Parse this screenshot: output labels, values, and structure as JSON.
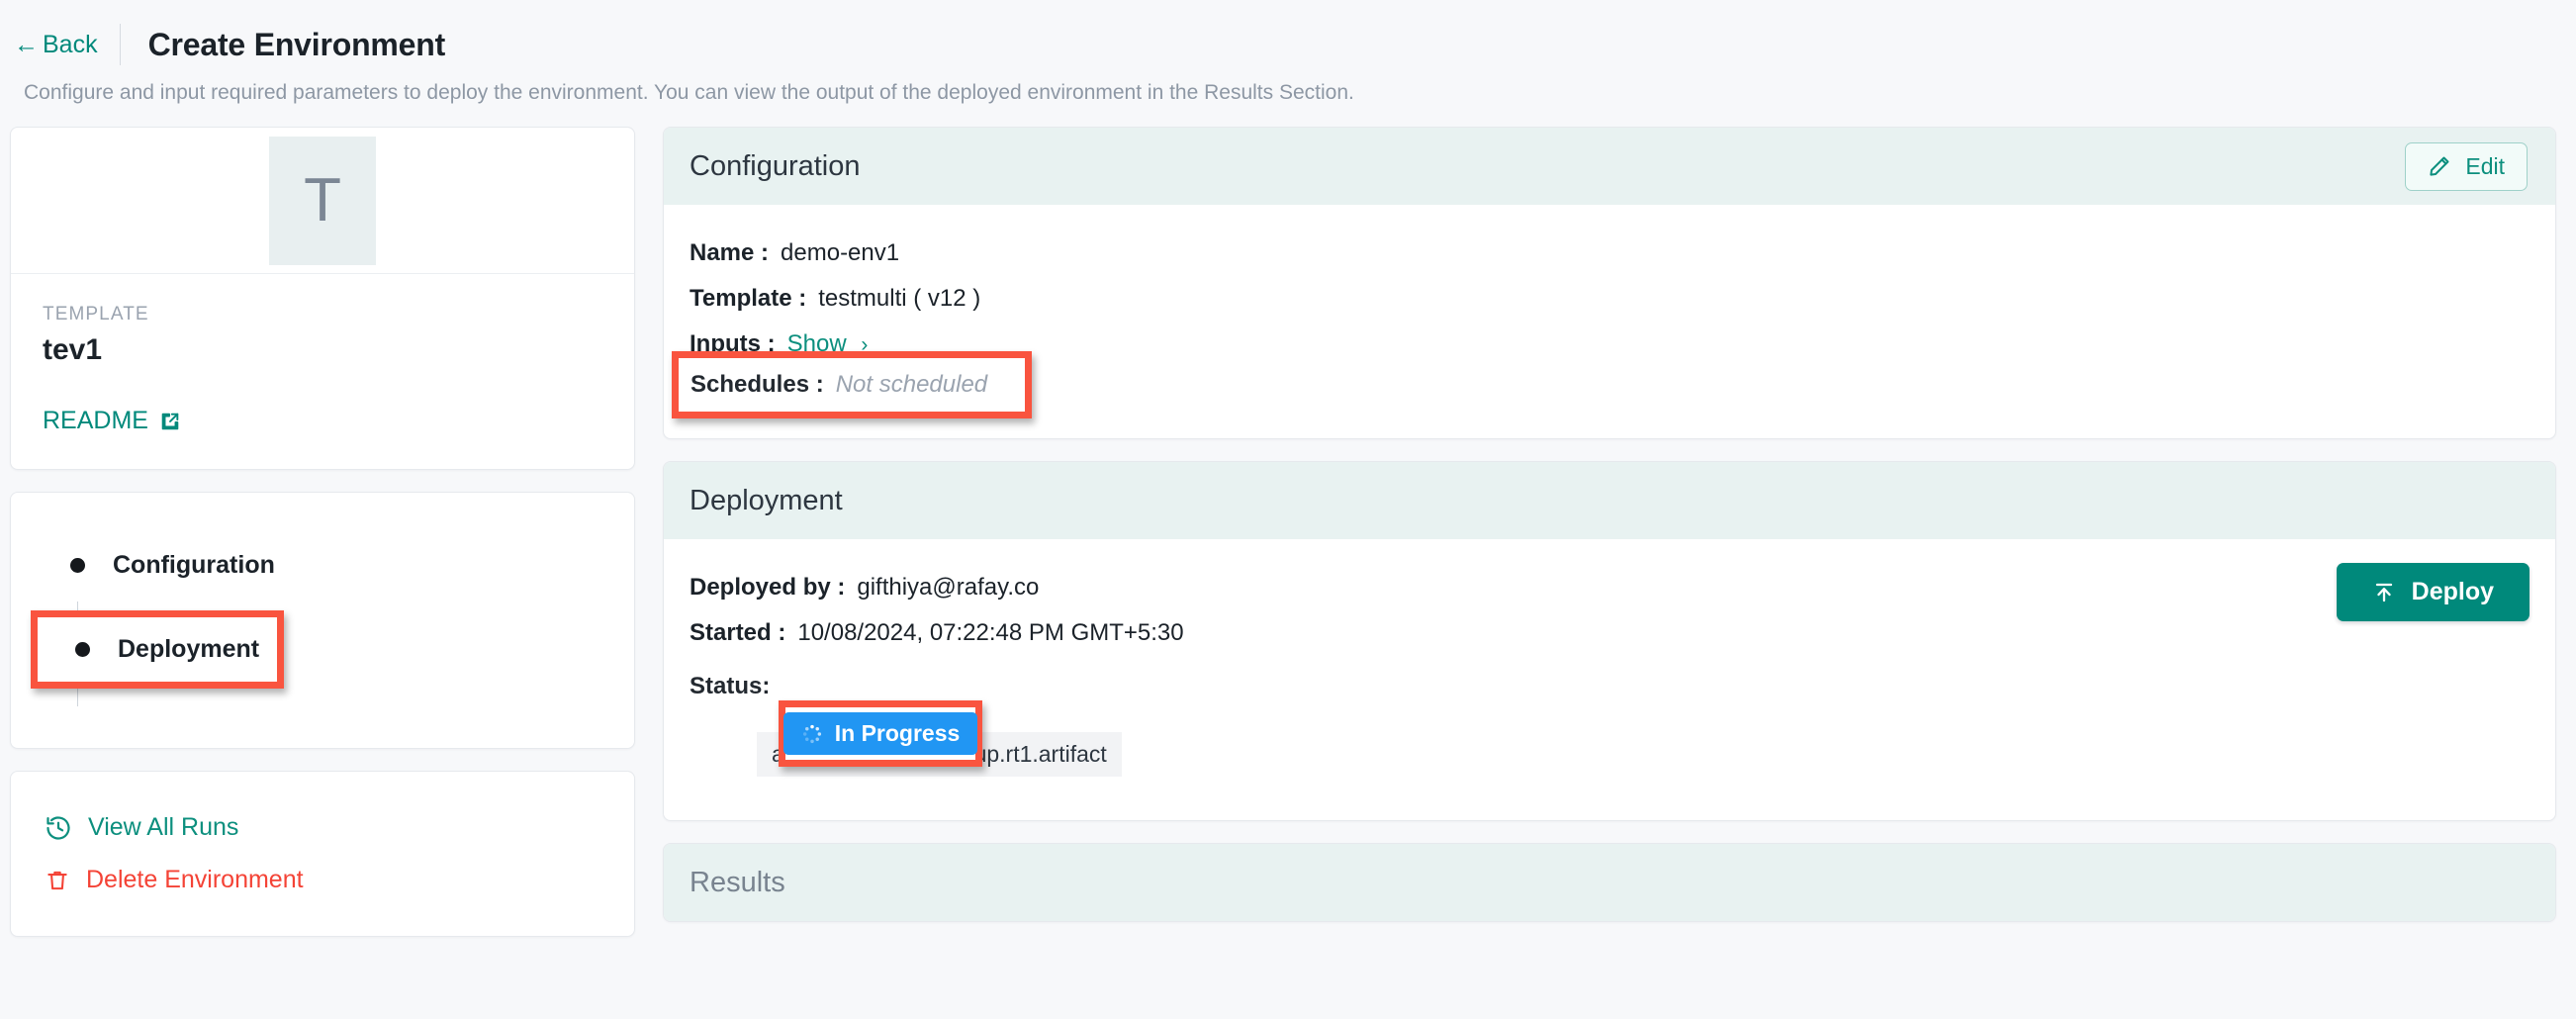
{
  "header": {
    "back_label": "Back",
    "back_icon": "arrow-left-icon",
    "title": "Create Environment",
    "subtitle": "Configure and input required parameters to deploy the environment. You can view the output of the deployed environment in the Results Section."
  },
  "sidebar": {
    "template_card": {
      "avatar_initial": "T",
      "label": "TEMPLATE",
      "name": "tev1",
      "readme_label": "README",
      "readme_icon": "external-link-icon"
    },
    "steps": [
      {
        "label": "Configuration",
        "state": "active"
      },
      {
        "label": "Deployment",
        "state": "active"
      },
      {
        "label": "Results",
        "state": "inactive"
      }
    ],
    "actions": [
      {
        "label": "View All Runs",
        "icon": "history-clock-icon",
        "color": "#0c8f7e"
      },
      {
        "label": "Delete Environment",
        "icon": "trash-icon",
        "color": "#f44336"
      }
    ]
  },
  "configuration": {
    "panel_title": "Configuration",
    "edit_label": "Edit",
    "edit_icon": "pencil-icon",
    "name_key": "Name :",
    "name_value": "demo-env1",
    "template_key": "Template :",
    "template_value": "testmulti  ( v12 )",
    "inputs_key": "Inputs :",
    "inputs_link": "Show",
    "inputs_chevron": "chevron-right-icon",
    "schedules_key": "Schedules :",
    "schedules_value": "Not scheduled"
  },
  "deployment": {
    "panel_title": "Deployment",
    "deployed_by_key": "Deployed by :",
    "deployed_by_value": "gifthiya@rafay.co",
    "started_key": "Started :",
    "started_value": "10/08/2024, 07:22:48 PM GMT+5:30",
    "status_key": "Status:",
    "status_badge_label": "In Progress",
    "status_badge_icon": "loading-spinner-icon",
    "status_badge_color": "#2196f3",
    "activity_note": "activity pending: group.rt1.artifact",
    "deploy_label": "Deploy",
    "deploy_icon": "upload-icon",
    "deploy_color": "#00897b"
  },
  "results": {
    "panel_title": "Results"
  },
  "annotations": {
    "highlight_color": "#f9543f",
    "targets": [
      "schedules-row",
      "deployment-step",
      "status-badge"
    ]
  }
}
